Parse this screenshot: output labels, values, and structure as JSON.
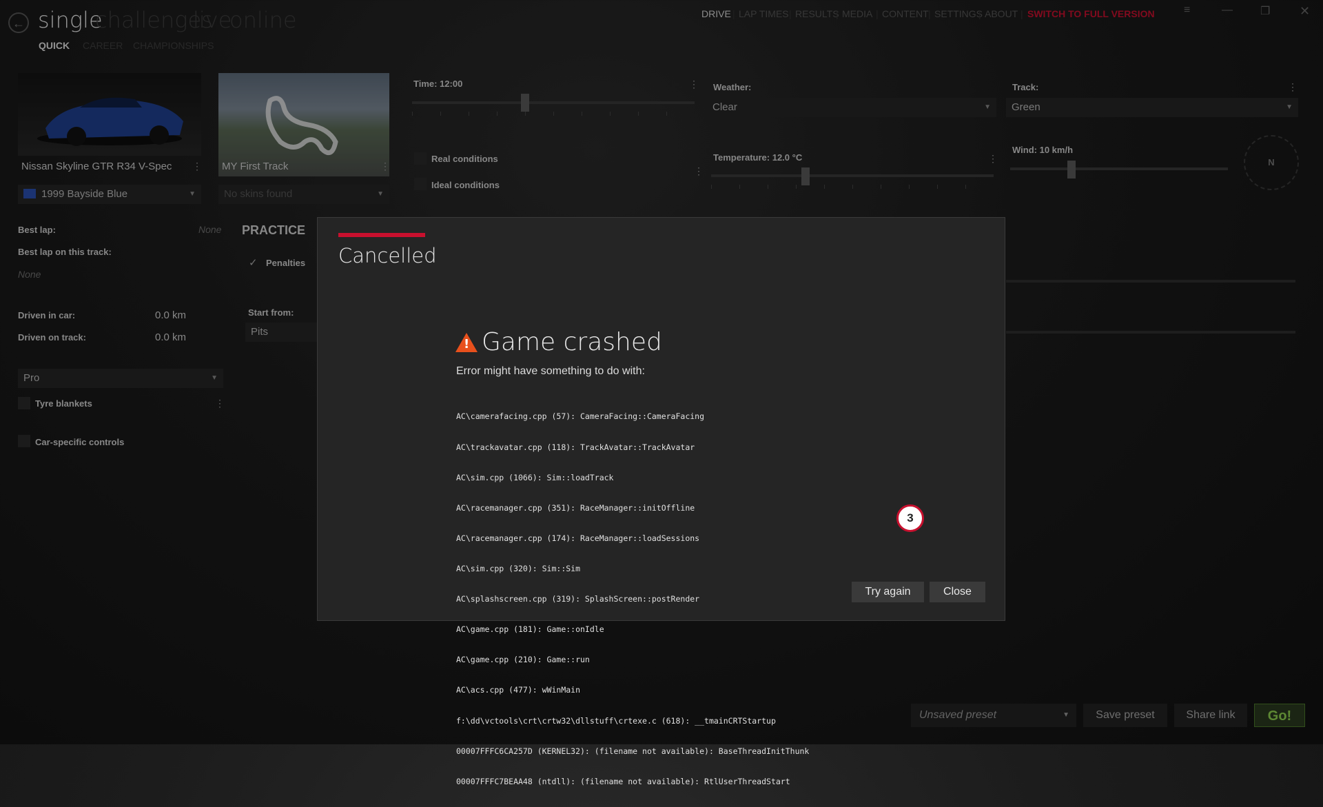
{
  "header": {
    "modes": [
      "single",
      "challenges",
      "live",
      "online"
    ],
    "submodes": [
      "QUICK",
      "CAREER",
      "CHAMPIONSHIPS"
    ],
    "nav": [
      "DRIVE",
      "LAP TIMES",
      "RESULTS",
      "MEDIA",
      "CONTENT",
      "SETTINGS",
      "ABOUT",
      "SWITCH TO FULL VERSION"
    ],
    "sep": "|"
  },
  "car": {
    "name": "Nissan Skyline GTR R34 V-Spec",
    "skin": "1999 Bayside Blue"
  },
  "track": {
    "name": "MY First Track",
    "skin": "No skins found"
  },
  "stats": {
    "best_lap_label": "Best lap:",
    "best_lap_value": "None",
    "best_lap_track_label": "Best lap on this track:",
    "best_lap_track_value": "None",
    "driven_car_label": "Driven in car:",
    "driven_car_value": "0.0 km",
    "driven_track_label": "Driven on track:",
    "driven_track_value": "0.0 km"
  },
  "assists": {
    "preset": "Pro",
    "tyre_blankets": "Tyre blankets",
    "car_controls": "Car-specific controls"
  },
  "session": {
    "mode": "PRACTICE",
    "penalties": "Penalties",
    "start_from_label": "Start from:",
    "start_from_value": "Pits"
  },
  "conditions": {
    "time_label": "Time: 12:00",
    "real_conditions": "Real conditions",
    "ideal_conditions": "Ideal conditions",
    "weather_label": "Weather:",
    "weather_value": "Clear",
    "track_label": "Track:",
    "track_value": "Green",
    "temperature_label": "Temperature: 12.0 °C",
    "wind_label": "Wind: 10 km/h",
    "compass": "N"
  },
  "dialog": {
    "title": "Cancelled",
    "crash_title": "Game crashed",
    "intro": "Error might have something to do with:",
    "trace": [
      "AC\\camerafacing.cpp (57): CameraFacing::CameraFacing",
      "AC\\trackavatar.cpp (118): TrackAvatar::TrackAvatar",
      "AC\\sim.cpp (1066): Sim::loadTrack",
      "AC\\racemanager.cpp (351): RaceManager::initOffline",
      "AC\\racemanager.cpp (174): RaceManager::loadSessions",
      "AC\\sim.cpp (320): Sim::Sim",
      "AC\\splashscreen.cpp (319): SplashScreen::postRender",
      "AC\\game.cpp (181): Game::onIdle",
      "AC\\game.cpp (210): Game::run",
      "AC\\acs.cpp (477): wWinMain",
      "f:\\dd\\vctools\\crt\\crtw32\\dllstuff\\crtexe.c (618): __tmainCRTStartup",
      "00007FFFC6CA257D (KERNEL32): (filename not available): BaseThreadInitThunk",
      "00007FFFC7BEAA48 (ntdll): (filename not available): RtlUserThreadStart"
    ],
    "try_again": "Try again",
    "close": "Close",
    "badge": "3"
  },
  "footer": {
    "preset": "Unsaved preset",
    "save_preset": "Save preset",
    "share_link": "Share link",
    "go": "Go!"
  },
  "colors": {
    "accent": "#c8102e",
    "go": "#8fd14f",
    "warning": "#e8501c"
  }
}
